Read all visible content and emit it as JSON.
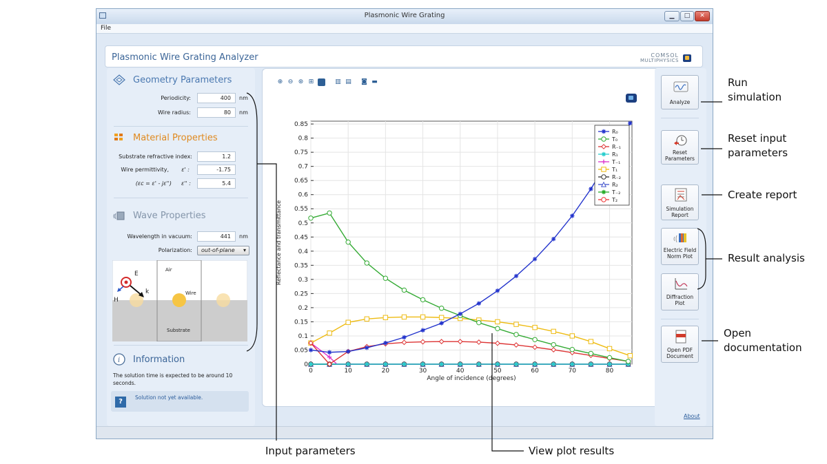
{
  "window": {
    "title": "Plasmonic Wire Grating",
    "menu": [
      "File"
    ],
    "controls": [
      "minimize",
      "maximize",
      "close"
    ]
  },
  "app": {
    "title": "Plasmonic Wire Grating Analyzer",
    "logo_line1": "COMSOL",
    "logo_line2": "MULTIPHYSICS"
  },
  "geometry": {
    "title": "Geometry Parameters",
    "icon": "geometry-icon",
    "periodicity_label": "Periodicity:",
    "periodicity_value": "400",
    "periodicity_unit": "nm",
    "wire_radius_label": "Wire radius:",
    "wire_radius_value": "80",
    "wire_radius_unit": "nm"
  },
  "material": {
    "title": "Material Properties",
    "icon": "material-icon",
    "substrate_label": "Substrate refractive index:",
    "substrate_value": "1.2",
    "perm_label": "Wire permittivity,",
    "perm_real_symbol": "ε' :",
    "perm_real_value": "-1.75",
    "perm_def_label": "(εc = ε' - jε'')",
    "perm_imag_symbol": "ε'' :",
    "perm_imag_value": "5.4"
  },
  "wave": {
    "title": "Wave Properties",
    "icon": "wave-icon",
    "wavelength_label": "Wavelength in vacuum:",
    "wavelength_value": "441",
    "wavelength_unit": "nm",
    "polarization_label": "Polarization:",
    "polarization_value": "out-of-plane"
  },
  "geometry_figure": {
    "air": "Air",
    "wire": "Wire",
    "substrate": "Substrate",
    "E": "E",
    "H": "H",
    "k": "k"
  },
  "information": {
    "title": "Information",
    "icon": "info-icon",
    "text": "The solution time is expected to be around 10 seconds.",
    "status": "Solution not yet available.",
    "status_icon": "question-icon"
  },
  "toolbar": {
    "icons": [
      "zoom-in-icon",
      "zoom-out-icon",
      "zoom-box-icon",
      "zoom-extents-icon",
      "scene-light-icon",
      "grid-icon",
      "legend-icon",
      "camera-icon",
      "print-icon"
    ]
  },
  "right_buttons": [
    {
      "label": "Analyze",
      "icon": "analyze-icon"
    },
    {
      "label": "Reset Parameters",
      "icon": "reset-icon"
    },
    {
      "label": "Simulation Report",
      "icon": "report-icon"
    },
    {
      "label": "Electric Field Norm Plot",
      "icon": "efield-plot-icon"
    },
    {
      "label": "Diffraction Plot",
      "icon": "diffraction-plot-icon"
    },
    {
      "label": "Open PDF Document",
      "icon": "pdf-icon"
    }
  ],
  "about": "About",
  "annotations": {
    "run": "Run simulation",
    "reset": "Reset input parameters",
    "report": "Create report",
    "result": "Result analysis",
    "open_doc": "Open documentation",
    "input": "Input parameters",
    "view": "View plot results"
  },
  "chart_data": {
    "type": "line",
    "xlabel": "Angle of incidence (degrees)",
    "ylabel": "Reflectance and transmittance",
    "xlim": [
      0,
      86
    ],
    "ylim": [
      0,
      0.86
    ],
    "xticks": [
      0,
      10,
      20,
      30,
      40,
      50,
      60,
      70,
      80
    ],
    "yticks": [
      0,
      0.05,
      0.1,
      0.15,
      0.2,
      0.25,
      0.3,
      0.35,
      0.4,
      0.45,
      0.5,
      0.55,
      0.6,
      0.65,
      0.7,
      0.75,
      0.8,
      0.85
    ],
    "ytick_labels": [
      "0",
      "0.05",
      "0.1",
      "0.15",
      "0.2",
      "0.25",
      "0.3",
      "0.35",
      "0.4",
      "0.45",
      "0.5",
      "0.55",
      "0.6",
      "0.65",
      "0.7",
      "0.75",
      "0.8",
      "0.85"
    ],
    "grid": true,
    "legend_position": "top-right",
    "x": [
      0,
      5,
      10,
      15,
      20,
      25,
      30,
      35,
      40,
      45,
      50,
      55,
      60,
      65,
      70,
      75,
      80,
      85
    ],
    "series": [
      {
        "name": "R₀",
        "color": "#2233cc",
        "marker": "star",
        "x": [
          0,
          5,
          10,
          15,
          20,
          25,
          30,
          35,
          40,
          45,
          50,
          55,
          60,
          65,
          70,
          75,
          80,
          85.5
        ],
        "values": [
          0.05,
          0.042,
          0.045,
          0.058,
          0.075,
          0.095,
          0.12,
          0.145,
          0.178,
          0.215,
          0.26,
          0.312,
          0.372,
          0.443,
          0.525,
          0.62,
          0.73,
          0.853
        ]
      },
      {
        "name": "T₀",
        "color": "#33aa33",
        "marker": "circle",
        "x": [
          0,
          5,
          10,
          15,
          20,
          25,
          30,
          35,
          40,
          45,
          50,
          55,
          60,
          65,
          70,
          75,
          80,
          85
        ],
        "values": [
          0.517,
          0.535,
          0.432,
          0.358,
          0.304,
          0.262,
          0.228,
          0.198,
          0.172,
          0.147,
          0.126,
          0.105,
          0.087,
          0.069,
          0.052,
          0.038,
          0.023,
          0.01
        ]
      },
      {
        "name": "R₋₁",
        "color": "#dd3333",
        "marker": "diamond",
        "x": [
          0,
          5,
          10,
          15,
          20,
          25,
          30,
          35,
          40,
          45,
          50,
          55,
          60,
          65,
          70,
          75,
          80,
          85
        ],
        "values": [
          0.075,
          0,
          0.045,
          0.062,
          0.072,
          0.077,
          0.079,
          0.08,
          0.08,
          0.078,
          0.074,
          0.068,
          0.06,
          0.051,
          0.041,
          0.031,
          0.02,
          0.01
        ]
      },
      {
        "name": "R₁",
        "color": "#22cccc",
        "marker": "star",
        "x": [
          0,
          5,
          10,
          15,
          20,
          25,
          30,
          35,
          40,
          45,
          50,
          55,
          60,
          65,
          70,
          75,
          80,
          85
        ],
        "values": [
          0,
          0,
          0,
          0,
          0,
          0,
          0,
          0,
          0,
          0,
          0,
          0,
          0,
          0,
          0,
          0,
          0,
          0
        ]
      },
      {
        "name": "T₋₁",
        "color": "#dd33cc",
        "marker": "plus",
        "x": [
          0,
          5,
          7,
          10,
          15,
          20,
          25,
          30,
          35,
          40,
          45,
          50,
          55,
          60,
          65,
          70,
          75,
          80,
          85
        ],
        "values": [
          0.075,
          0.025,
          0,
          0,
          0,
          0,
          0,
          0,
          0,
          0,
          0,
          0,
          0,
          0,
          0,
          0,
          0,
          0,
          0
        ]
      },
      {
        "name": "T₁",
        "color": "#eebb11",
        "marker": "square",
        "x": [
          0,
          5,
          10,
          15,
          20,
          25,
          30,
          35,
          40,
          45,
          50,
          55,
          60,
          65,
          70,
          75,
          80,
          85.5
        ],
        "values": [
          0.075,
          0.11,
          0.148,
          0.16,
          0.165,
          0.167,
          0.167,
          0.165,
          0.162,
          0.156,
          0.15,
          0.141,
          0.13,
          0.116,
          0.1,
          0.08,
          0.055,
          0.03
        ]
      },
      {
        "name": "R₋₂",
        "color": "#333333",
        "marker": "circle",
        "x": [
          0,
          5,
          10,
          15,
          20,
          25,
          30,
          35,
          40,
          45,
          50,
          55,
          60,
          65,
          70,
          75,
          80,
          85
        ],
        "values": [
          0,
          0,
          0,
          0,
          0,
          0,
          0,
          0,
          0,
          0,
          0,
          0,
          0,
          0,
          0,
          0,
          0,
          0
        ]
      },
      {
        "name": "R₂",
        "color": "#4455cc",
        "marker": "triangle",
        "x": [
          0,
          5,
          10,
          15,
          20,
          25,
          30,
          35,
          40,
          45,
          50,
          55,
          60,
          65,
          70,
          75,
          80,
          85
        ],
        "values": [
          0,
          0,
          0,
          0,
          0,
          0,
          0,
          0,
          0,
          0,
          0,
          0,
          0,
          0,
          0,
          0,
          0,
          0
        ]
      },
      {
        "name": "T₋₂",
        "color": "#22aa22",
        "marker": "star",
        "x": [
          0,
          5,
          10,
          15,
          20,
          25,
          30,
          35,
          40,
          45,
          50,
          55,
          60,
          65,
          70,
          75,
          80,
          85
        ],
        "values": [
          0,
          0,
          0,
          0,
          0,
          0,
          0,
          0,
          0,
          0,
          0,
          0,
          0,
          0,
          0,
          0,
          0,
          0
        ]
      },
      {
        "name": "T₂",
        "color": "#ee3333",
        "marker": "circle",
        "x": [
          0,
          5,
          10,
          15,
          20,
          25,
          30,
          35,
          40,
          45,
          50,
          55,
          60,
          65,
          70,
          75,
          80,
          85
        ],
        "values": [
          0,
          0,
          0,
          0,
          0,
          0,
          0,
          0,
          0,
          0,
          0,
          0,
          0,
          0,
          0,
          0,
          0,
          0
        ]
      }
    ]
  }
}
